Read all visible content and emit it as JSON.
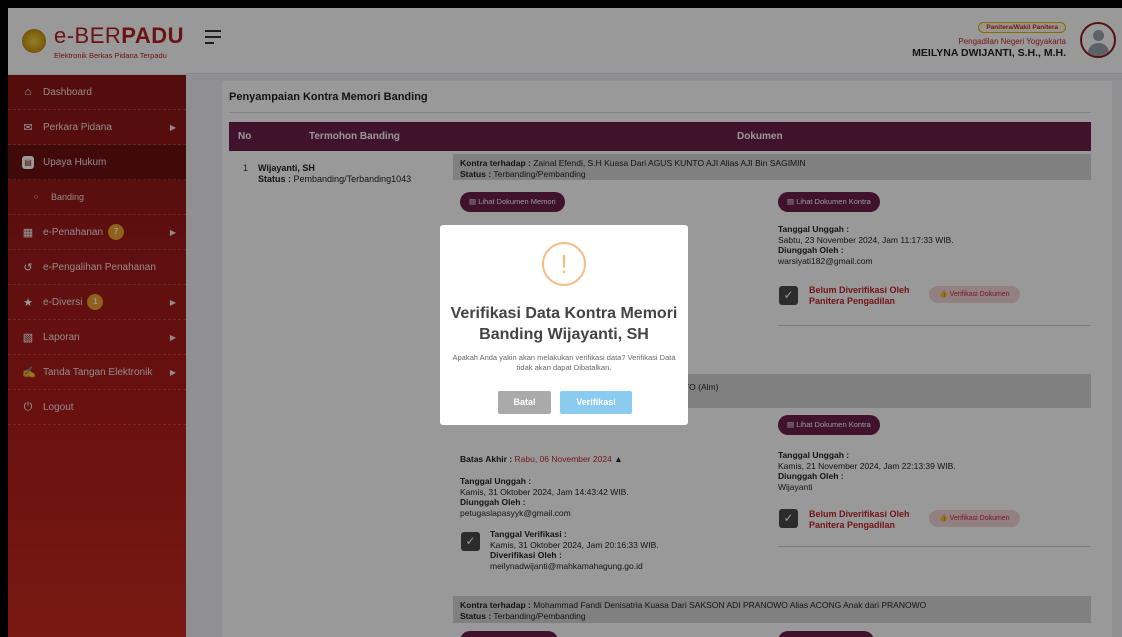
{
  "header": {
    "logo_brand": "e-BER",
    "logo_brand_bold": "PADU",
    "logo_subtitle": "Elektronik Berkas Pidana Terpadu",
    "role_badge": "Panitera/Wakil Panitera",
    "court": "Pengadilan Negeri Yogyakarta",
    "user_name": "MEILYNA DWIJANTI, S.H., M.H."
  },
  "sidebar": {
    "items": [
      {
        "label": "Dashboard",
        "icon": "home-icon"
      },
      {
        "label": "Perkara Pidana",
        "icon": "mail-icon"
      },
      {
        "label": "Upaya Hukum",
        "icon": "document-icon"
      },
      {
        "label": "Banding",
        "icon": "circle-icon"
      },
      {
        "label": "e-Penahanan",
        "icon": "grid-icon",
        "badge": "7"
      },
      {
        "label": "e-Pengalihan Penahanan",
        "icon": "history-icon"
      },
      {
        "label": "e-Diversi",
        "icon": "star-icon",
        "badge": "1"
      },
      {
        "label": "Laporan",
        "icon": "report-icon"
      },
      {
        "label": "Tanda Tangan Elektronik",
        "icon": "signature-icon"
      },
      {
        "label": "Logout",
        "icon": "power-icon"
      }
    ]
  },
  "page": {
    "title": "Penyampaian Kontra Memori Banding",
    "columns": {
      "no": "No",
      "termohon": "Termohon Banding",
      "dokumen": "Dokumen"
    }
  },
  "row1": {
    "no": "1",
    "name": "Wijayanti, SH",
    "status_label": "Status :",
    "status_value": "Pembanding/Terbanding1043"
  },
  "entries": [
    {
      "kontra_label": "Kontra terhadap :",
      "kontra_value": "Zainal Efendi, S.H Kuasa Dari AGUS KUNTO AJI Alias AJI Bin SAGIMIN",
      "status_label": "Status :",
      "status_value": "Terbanding/Pembanding",
      "btn_memori": "Lihat Dokumen Memori",
      "btn_kontra": "Lihat Dokumen Kontra",
      "upload_label": "Tanggal Unggah :",
      "upload_value": "Sabtu, 23 November 2024, Jam 11:17:33 WIB.",
      "by_label": "Diunggah Oleh :",
      "by_value": "warsiyati182@gmail.com",
      "not_verified_1": "Belum Diverifikasi Oleh",
      "not_verified_2": "Panitera Pengadilan",
      "verify_btn": "Verifikasi Dokumen"
    },
    {
      "kontra_fragment": "NTO (Alm)",
      "btn_kontra": "Lihat Dokumen Kontra",
      "deadline_label": "Batas Akhir :",
      "deadline_value": "Rabu, 06 November 2024",
      "mem_upload_label": "Tanggal Unggah :",
      "mem_upload_value": "Kamis, 31 Oktober 2024, Jam 14:43:42 WIB.",
      "mem_by_label": "Diunggah Oleh :",
      "mem_by_value": "petugaslapasyyk@gmail.com",
      "ver_date_label": "Tanggal Verifikasi :",
      "ver_date_value": "Kamis, 31 Oktober 2024, Jam 20:16:33 WIB.",
      "ver_by_label": "Diverifikasi Oleh :",
      "ver_by_value": "meilynadwijanti@mahkamahagung.go.id",
      "upload_label": "Tanggal Unggah :",
      "upload_value": "Kamis, 21 November 2024, Jam 22:13:39 WIB.",
      "by_label": "Diunggah Oleh :",
      "by_value": "Wijayanti",
      "not_verified_1": "Belum Diverifikasi Oleh",
      "not_verified_2": "Panitera Pengadilan",
      "verify_btn": "Verifikasi Dokumen"
    },
    {
      "kontra_label": "Kontra terhadap :",
      "kontra_value": "Mohammad Fandi Denisatria Kuasa Dari SAKSON ADI PRANOWO Alias ACONG Anak dari PRANOWO",
      "status_label": "Status :",
      "status_value": "Terbanding/Pembanding"
    }
  ],
  "modal": {
    "icon": "!",
    "title": "Verifikasi Data Kontra Memori Banding Wijayanti, SH",
    "text": "Apakah Anda yakin akan melakukan verifikasi data? Verifikasi Data tidak akan dapat Dibatalkan.",
    "cancel": "Batal",
    "confirm": "Verifikasi"
  }
}
